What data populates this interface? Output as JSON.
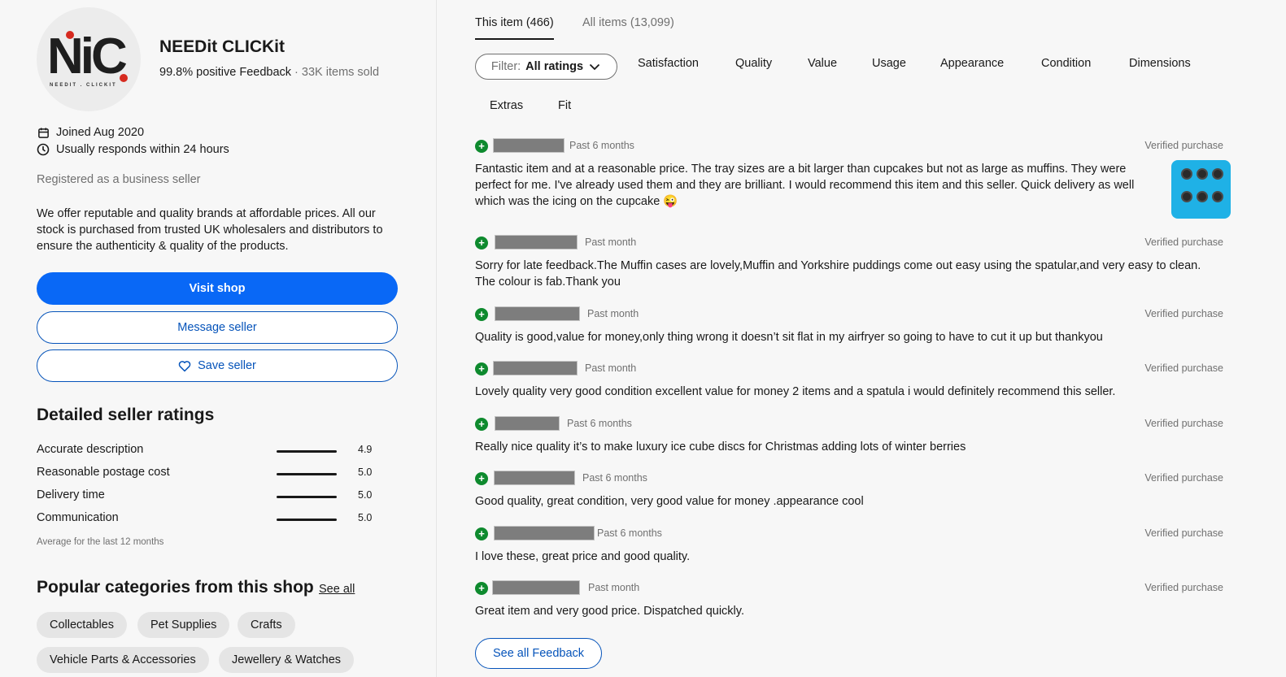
{
  "seller": {
    "logo_text": "NiC",
    "logo_subtext": "NEEDIT . CLICKIT",
    "name": "NEEDit CLICKit",
    "feedback": "99.8% positive Feedback",
    "separator": "·",
    "items_sold": "33K items sold",
    "joined": "Joined Aug 2020",
    "responds": "Usually responds within 24 hours",
    "registered": "Registered as a business seller",
    "description": "We offer reputable and quality brands at affordable prices. All our stock is purchased from trusted UK wholesalers and distributors to ensure the authenticity & quality of the products."
  },
  "actions": {
    "visit_shop": "Visit shop",
    "message_seller": "Message seller",
    "save_seller": "Save seller"
  },
  "detailed_ratings": {
    "title": "Detailed seller ratings",
    "items": [
      {
        "label": "Accurate description",
        "value": "4.9"
      },
      {
        "label": "Reasonable postage cost",
        "value": "5.0"
      },
      {
        "label": "Delivery time",
        "value": "5.0"
      },
      {
        "label": "Communication",
        "value": "5.0"
      }
    ],
    "note": "Average for the last 12 months"
  },
  "popular": {
    "title": "Popular categories from this shop",
    "see_all": "See all",
    "categories": [
      "Collectables",
      "Pet Supplies",
      "Crafts",
      "Vehicle Parts & Accessories",
      "Jewellery & Watches"
    ]
  },
  "tabs": {
    "this_item": "This item (466)",
    "all_items": "All items (13,099)"
  },
  "filter": {
    "label": "Filter:",
    "value": "All ratings",
    "aspects": [
      "Satisfaction",
      "Quality",
      "Value",
      "Usage",
      "Appearance",
      "Condition",
      "Dimensions",
      "Extras",
      "Fit"
    ]
  },
  "reviews": [
    {
      "time": "Past 6 months",
      "verified": "Verified purchase",
      "text": "Fantastic item and at a reasonable price. The tray sizes are a bit larger than cupcakes but not as large as muffins. They were perfect for me. I've already used them and they are brilliant. I would recommend this item and this seller. Quick delivery as well which was the icing on the cupcake 😜"
    },
    {
      "time": "Past month",
      "verified": "Verified purchase",
      "text": "Sorry for late feedback.The Muffin cases are lovely,Muffin and Yorkshire puddings come out easy using the spatular,and very easy to clean. The colour is fab.Thank you"
    },
    {
      "time": "Past month",
      "verified": "Verified purchase",
      "text": "Quality is good,value for money,only thing wrong it doesn’t sit flat in my airfryer so going to have to cut it up but thankyou"
    },
    {
      "time": "Past month",
      "verified": "Verified purchase",
      "text": "Lovely quality very good condition excellent value for money 2 items and a spatula i would definitely recommend this seller."
    },
    {
      "time": "Past 6 months",
      "verified": "Verified purchase",
      "text": "Really nice quality it’s to make luxury ice cube discs for Christmas adding lots of winter berries"
    },
    {
      "time": "Past 6 months",
      "verified": "Verified purchase",
      "text": "Good quality, great condition, very good value for money .appearance cool"
    },
    {
      "time": "Past 6 months",
      "verified": "Verified purchase",
      "text": "I love these, great price and good quality."
    },
    {
      "time": "Past month",
      "verified": "Verified purchase",
      "text": "Great item and very good price. Dispatched quickly."
    }
  ],
  "see_all_feedback": "See all Feedback",
  "colors": {
    "primary": "#0968f6",
    "link": "#0654ba",
    "positive": "#0e8a2e"
  }
}
